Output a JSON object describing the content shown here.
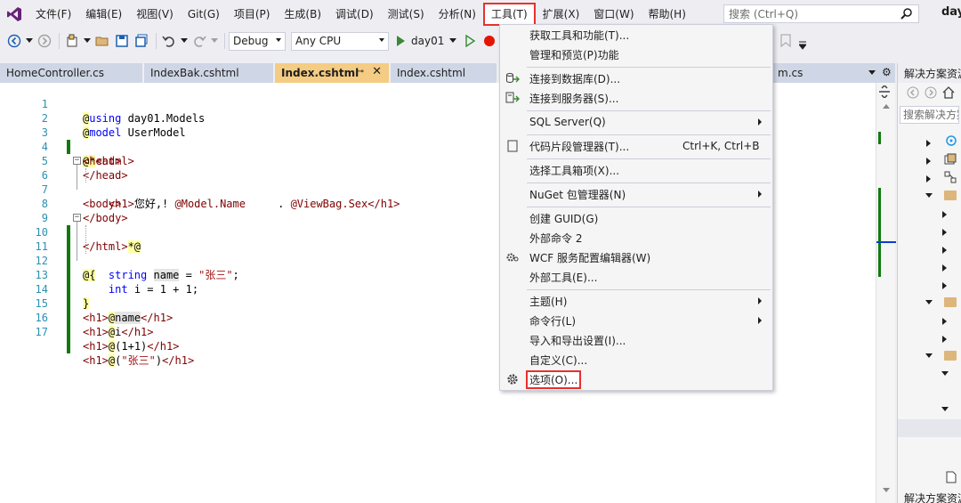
{
  "menubar": {
    "items": [
      "文件(F)",
      "编辑(E)",
      "视图(V)",
      "Git(G)",
      "项目(P)",
      "生成(B)",
      "调试(D)",
      "测试(S)",
      "分析(N)",
      "工具(T)",
      "扩展(X)",
      "窗口(W)",
      "帮助(H)"
    ],
    "active": "工具(T)",
    "search_placeholder": "搜索 (Ctrl+Q)",
    "project_name": "day"
  },
  "toolbar": {
    "config": "Debug",
    "platform": "Any CPU",
    "run_target": "day01"
  },
  "tabs": [
    {
      "label": "HomeController.cs"
    },
    {
      "label": "IndexBak.cshtml"
    },
    {
      "label": "Index.cshtml",
      "active": true
    },
    {
      "label": "Index.cshtml"
    }
  ],
  "tab_tail_label": "m.cs",
  "editor": {
    "line_numbers": [
      "1",
      "2",
      "3",
      "4",
      "5",
      "6",
      "7",
      "8",
      "9",
      "10",
      "11",
      "12",
      "13",
      "14",
      "15",
      "16",
      "17"
    ]
  },
  "tools_menu": {
    "items": [
      {
        "label": "获取工具和功能(T)..."
      },
      {
        "label": "管理和预览(P)功能"
      },
      {
        "label": "连接到数据库(D)...",
        "icon": "database-connect-icon"
      },
      {
        "label": "连接到服务器(S)...",
        "icon": "server-connect-icon"
      },
      {
        "label": "SQL Server(Q)",
        "submenu": true
      },
      {
        "label": "代码片段管理器(T)...",
        "shortcut": "Ctrl+K, Ctrl+B",
        "icon": "snippet-icon"
      },
      {
        "label": "选择工具箱项(X)..."
      },
      {
        "label": "NuGet 包管理器(N)",
        "submenu": true
      },
      {
        "label": "创建 GUID(G)"
      },
      {
        "label": "外部命令 2"
      },
      {
        "label": "WCF 服务配置编辑器(W)",
        "icon": "wcf-gear-icon"
      },
      {
        "label": "外部工具(E)..."
      },
      {
        "label": "主题(H)",
        "submenu": true
      },
      {
        "label": "命令行(L)",
        "submenu": true
      },
      {
        "label": "导入和导出设置(I)..."
      },
      {
        "label": "自定义(C)..."
      },
      {
        "label": "选项(O)...",
        "icon": "gear-icon",
        "highlighted": true
      }
    ]
  },
  "solution_explorer": {
    "title": "解决方案资源管理器",
    "search_placeholder": "搜索解决方案资源管理器",
    "bottom_label": "解决方案资源管理器"
  },
  "colors": {
    "accent_red": "#e8312b",
    "active_tab": "#f5cc84",
    "change_bar": "#0f7b0f",
    "line_number": "#2b91af"
  }
}
